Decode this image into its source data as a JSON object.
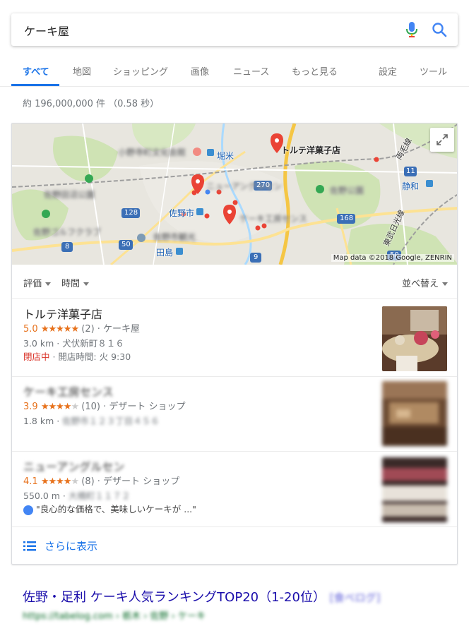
{
  "search": {
    "query": "ケーキ屋"
  },
  "tabs": [
    {
      "label": "すべて"
    },
    {
      "label": "地図"
    },
    {
      "label": "ショッピング"
    },
    {
      "label": "画像"
    },
    {
      "label": "ニュース"
    },
    {
      "label": "もっと見る"
    },
    {
      "label": "設定"
    },
    {
      "label": "ツール"
    }
  ],
  "stats": "約 196,000,000 件 （0.58 秒）",
  "map": {
    "credit": "Map data ©2018 Google, ZENRIN",
    "labels": {
      "shop1": "トルテ洋菓子店",
      "horigome": "堀米",
      "sano": "佐野市",
      "tajima": "田島",
      "shizuwa": "静和",
      "ryomo": "両毛線",
      "tobu": "東武日光線",
      "r128": "128",
      "r270": "270",
      "r168": "168",
      "r11": "11",
      "r8": "8",
      "r50a": "50",
      "r50b": "50",
      "r9": "9"
    }
  },
  "filters": {
    "rating": "評価",
    "time": "時間",
    "sort": "並べ替え"
  },
  "listings": [
    {
      "name": "トルテ洋菓子店",
      "score": "5.0",
      "stars": "★★★★★",
      "empty": "",
      "reviews": "(2) · ケーキ屋",
      "line2": "3.0 km · 犬伏新町８１６",
      "status": "閉店中",
      "hours": " · 開店時間: 火 9:30"
    },
    {
      "name": "ケーキ工房センス",
      "score": "3.9",
      "stars": "★★★★",
      "empty": "★",
      "reviews": "(10) · デザート ショップ",
      "line2": "1.8 km · ",
      "address": "佐野市１２３丁目４５６"
    },
    {
      "name": "ニューアングルセン",
      "score": "4.1",
      "stars": "★★★★",
      "empty": "★",
      "reviews": "(8) · デザート ショップ",
      "line2": "550.0 m · ",
      "address": "大橋町１１７２"
    }
  ],
  "review_snippet": "\"良心的な価格で、美味しいケーキが ...\"",
  "more": "さらに表示",
  "result": {
    "title": "佐野・足利 ケーキ人気ランキングTOP20（1-20位）",
    "badge": "[食べログ]",
    "url": "https://tabelog.com › 栃木 › 佐野 › ケーキ"
  },
  "colors": {
    "accent": "#1a73e8",
    "star": "#e7711b",
    "closed": "#d93025",
    "link": "#1a0dab"
  }
}
